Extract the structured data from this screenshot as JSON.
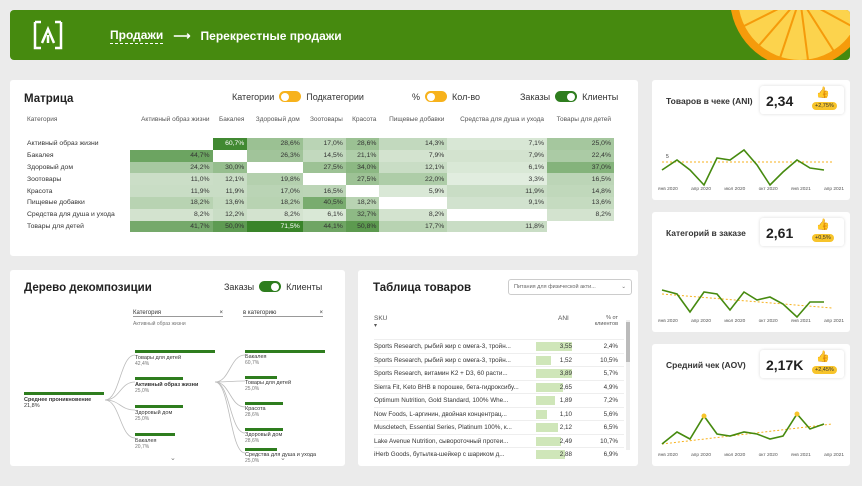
{
  "breadcrumb": {
    "item1": "Продажи",
    "arrow": "⟶",
    "item2": "Перекрестные продажи"
  },
  "colors": {
    "brand": "#468a0f",
    "accent": "#f7b21c",
    "dark": "#2e7d1e"
  },
  "matrix": {
    "title": "Матрица",
    "toggle1": {
      "left": "Категории",
      "right": "Подкатегории"
    },
    "toggle2": {
      "left": "%",
      "right": "Кол-во"
    },
    "toggle3": {
      "left": "Заказы",
      "right": "Клиенты"
    },
    "corner": "Категория",
    "columns": [
      "Активный образ жизни",
      "Бакалея",
      "Здоровый дом",
      "Зоотовары",
      "Красота",
      "Пищевые добавки",
      "Средства для душа и ухода",
      "Товары для детей"
    ],
    "rows": [
      {
        "label": "Активный образ жизни",
        "cells": [
          "",
          "60,7%",
          "28,6%",
          "17,0%",
          "28,6%",
          "14,3%",
          "7,1%",
          "25,0%"
        ]
      },
      {
        "label": "Бакалея",
        "cells": [
          "44,7%",
          "",
          "26,3%",
          "14,5%",
          "21,1%",
          "7,9%",
          "7,9%",
          "22,4%"
        ]
      },
      {
        "label": "Здоровый дом",
        "cells": [
          "24,2%",
          "30,0%",
          "",
          "27,5%",
          "34,0%",
          "12,1%",
          "6,1%",
          "37,0%"
        ]
      },
      {
        "label": "Зоотовары",
        "cells": [
          "11,0%",
          "12,1%",
          "19,8%",
          "",
          "27,5%",
          "22,0%",
          "3,3%",
          "16,5%"
        ]
      },
      {
        "label": "Красота",
        "cells": [
          "11,9%",
          "11,9%",
          "17,0%",
          "16,5%",
          "",
          "5,9%",
          "11,9%",
          "14,8%"
        ]
      },
      {
        "label": "Пищевые добавки",
        "cells": [
          "18,2%",
          "13,6%",
          "18,2%",
          "40,5%",
          "18,2%",
          "",
          "9,1%",
          "13,6%"
        ]
      },
      {
        "label": "Средства для душа и ухода",
        "cells": [
          "8,2%",
          "12,2%",
          "8,2%",
          "6,1%",
          "32,7%",
          "8,2%",
          "",
          "8,2%"
        ]
      },
      {
        "label": "Товары для детей",
        "cells": [
          "41,7%",
          "50,0%",
          "71,5%",
          "44,1%",
          "50,8%",
          "17,7%",
          "11,8%",
          ""
        ]
      }
    ]
  },
  "tree": {
    "title": "Дерево декомпозиции",
    "toggle": {
      "left": "Заказы",
      "right": "Клиенты"
    },
    "col1": {
      "header": "Категория",
      "sub": "Активный образ жизни"
    },
    "col2": {
      "header": "в категорию"
    },
    "root": {
      "label": "Среднее проникновение",
      "value": "21,8%"
    },
    "level1": [
      {
        "label": "Товары для детей",
        "value": "42,4%",
        "fill": 1.0
      },
      {
        "label": "Активный образ жизни",
        "value": "25,0%",
        "fill": 0.6
      },
      {
        "label": "Здоровый дом",
        "value": "25,0%",
        "fill": 0.6
      },
      {
        "label": "Бакалея",
        "value": "20,7%",
        "fill": 0.5
      }
    ],
    "level2": [
      {
        "label": "Бакалея",
        "value": "60,7%",
        "fill": 1.0
      },
      {
        "label": "Товары для детей",
        "value": "25,0%",
        "fill": 0.4
      },
      {
        "label": "Красота",
        "value": "28,6%",
        "fill": 0.47
      },
      {
        "label": "Здоровый дом",
        "value": "28,6%",
        "fill": 0.47
      },
      {
        "label": "Средства для душа и ухода",
        "value": "25,0%",
        "fill": 0.4
      }
    ]
  },
  "products": {
    "title": "Таблица товаров",
    "filter": "Питания для физической акти...",
    "headers": {
      "sku": "SKU",
      "ani": "ANI",
      "pct": "% от клиентов"
    },
    "rows": [
      {
        "sku": "Sports Research, рыбий жир с омега-3, тройн...",
        "ani": "3,55",
        "pct": "2,4%",
        "fill": 1.0
      },
      {
        "sku": "Sports Research, рыбий жир с омега-3, тройн...",
        "ani": "1,52",
        "pct": "10,5%",
        "fill": 0.43
      },
      {
        "sku": "Sports Research, витамин K2 + D3, 60 расти...",
        "ani": "3,89",
        "pct": "5,7%",
        "fill": 1.0
      },
      {
        "sku": "Sierra Fit, Keto BHB в порошке, бета-гидроксибу...",
        "ani": "2,65",
        "pct": "4,9%",
        "fill": 0.75
      },
      {
        "sku": "Optimum Nutrition, Gold Standard, 100% Whe...",
        "ani": "1,89",
        "pct": "7,2%",
        "fill": 0.53
      },
      {
        "sku": "Now Foods, L-аргинин, двойная концентрац...",
        "ani": "1,10",
        "pct": "5,6%",
        "fill": 0.31
      },
      {
        "sku": "Muscletech, Essential Series, Platinum 100%, к...",
        "ani": "2,12",
        "pct": "6,5%",
        "fill": 0.6
      },
      {
        "sku": "Lake Avenue Nutrition, сывороточный протеи...",
        "ani": "2,49",
        "pct": "10,7%",
        "fill": 0.7
      },
      {
        "sku": "iHerb Goods, бутылка-шейкер с шариком д...",
        "ani": "2,88",
        "pct": "6,9%",
        "fill": 0.81
      }
    ]
  },
  "kpis": [
    {
      "title": "Товаров в чеке (ANI)",
      "value": "2,34",
      "badge": "+2,75%",
      "axis": [
        "янв 2020",
        "апр 2020",
        "июл 2020",
        "окт 2020",
        "янв 2021",
        "апр 2021"
      ],
      "tick": "5"
    },
    {
      "title": "Категорий в заказе",
      "value": "2,61",
      "badge": "+0,5%",
      "axis": [
        "янв 2020",
        "апр 2020",
        "июл 2020",
        "окт 2020",
        "янв 2021",
        "апр 2021"
      ]
    },
    {
      "title": "Средний чек (AOV)",
      "value": "2,17K",
      "badge": "+2,45%",
      "axis": [
        "янв 2020",
        "апр 2020",
        "июл 2020",
        "окт 2020",
        "янв 2021",
        "апр 2021"
      ]
    }
  ]
}
